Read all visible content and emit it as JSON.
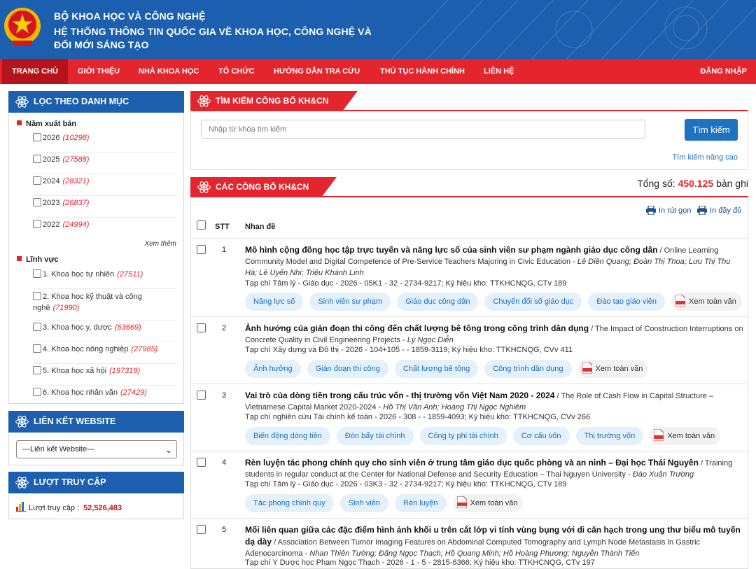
{
  "header": {
    "line1": "BỘ KHOA HỌC VÀ CÔNG NGHỆ",
    "line2": "HỆ THỐNG THÔNG TIN QUỐC GIA VỀ KHOA HỌC, CÔNG NGHỆ VÀ ĐỔI MỚI SÁNG TẠO"
  },
  "nav": {
    "items": [
      "TRANG CHỦ",
      "GIỚI THIỆU",
      "NHÀ KHOA HỌC",
      "TỔ CHỨC",
      "HƯỚNG DẪN TRA CỨU",
      "THỦ TỤC HÀNH CHÍNH",
      "LIÊN HỆ"
    ],
    "login": "ĐĂNG NHẬP"
  },
  "sidebar": {
    "filter_title": "LỌC THEO DANH MỤC",
    "year_title": "Năm xuất bản",
    "years": [
      {
        "label": "2026",
        "count": "(10298)"
      },
      {
        "label": "2025",
        "count": "(27588)"
      },
      {
        "label": "2024",
        "count": "(28321)"
      },
      {
        "label": "2023",
        "count": "(26837)"
      },
      {
        "label": "2022",
        "count": "(24994)"
      }
    ],
    "see_more": "Xem thêm",
    "field_title": "Lĩnh vực",
    "fields": [
      {
        "label": "1. Khoa học tự nhiên",
        "count": "(27511)"
      },
      {
        "label": "2. Khoa học kỹ thuật và công nghệ",
        "count": "(71990)"
      },
      {
        "label": "3. Khoa học y, dược",
        "count": "(63669)"
      },
      {
        "label": "4. Khoa học nông nghiệp",
        "count": "(27985)"
      },
      {
        "label": "5. Khoa học xã hội",
        "count": "(197319)"
      },
      {
        "label": "6. Khoa học nhân văn",
        "count": "(27429)"
      }
    ],
    "links_title": "LIÊN KẾT WEBSITE",
    "links_select": "---Liên kết Website---",
    "visits_title": "LƯỢT TRUY CẬP",
    "visits_label": "Lượt truy cập :",
    "visits_value": "52,526,483"
  },
  "search": {
    "title": "TÌM KIẾM CÔNG BỐ KH&CN",
    "placeholder": "Nhập từ khóa tìm kiếm",
    "button": "Tìm kiếm",
    "advanced": "Tìm kiếm nâng cao"
  },
  "list": {
    "title": "CÁC CÔNG BỐ KH&CN",
    "total_label": "Tổng số:",
    "total_value": "450.125",
    "total_unit": "bản ghi",
    "print_short": "In rút gọn",
    "print_full": "In đầy đủ",
    "col_stt": "STT",
    "col_title": "Nhan đề",
    "fulltext_label": "Xem toàn văn",
    "items": [
      {
        "stt": "1",
        "title_vi": "Mô hình cộng đồng học tập trực tuyến và năng lực số của sinh viên sư phạm ngành giáo dục công dân",
        "title_en": " / Online Learning Community Model and Digital Competence of Pre-Service Teachers Majoring in Civic Education - ",
        "authors": "Lê Diên Quang; Đoàn Thị Thoa; Lưu Thị Thu Hà; Lê Uyển Nhi; Triệu Khánh Linh",
        "journal": "Tạp chí Tâm lý - Giáo dục - 2026 - 05K1 - 32 - 2734-9217; Ký hiệu kho: TTKHCNQG, CTv 189",
        "tags": [
          "Năng lực số",
          "Sinh viên sư phạm",
          "Giáo dục công dân",
          "Chuyển đổi số giáo dục",
          "Đào tạo giáo viên"
        ]
      },
      {
        "stt": "2",
        "title_vi": "Ảnh hưởng của gián đoạn thi công đến chất lượng bê tông trong công trình dân dụng",
        "title_en": " / The Impact of Construction Interruptions on Concrete Quality in Civil Engineering Projects - ",
        "authors": "Lý Ngọc Diễn",
        "journal": "Tạp chí Xây dựng và Đô thị - 2026 - 104+105 - - 1859-3119; Ký hiệu kho: TTKHCNQG, CVv 411",
        "tags": [
          "Ảnh hưởng",
          "Gián đoạn thi công",
          "Chất lượng bê tông",
          "Công trình dân dụng"
        ]
      },
      {
        "stt": "3",
        "title_vi": "Vai trò của dòng tiền trong cấu trúc vốn - thị trường vốn Việt Nam 2020 - 2024",
        "title_en": " / The Role of Cash Flow in Capital Structure – Vietnamese Capital Market 2020-2024 - ",
        "authors": "Hồ Thị Vân Anh; Hoàng Thị Ngọc Nghiêm",
        "journal": "Tạp chí nghiên cứu Tài chính kế toán - 2026 - 308 - - 1859-4093; Ký hiệu kho: TTKHCNQG, CVv 266",
        "tags": [
          "Biến động dòng tiền",
          "Đòn bẩy tài chính",
          "Công ty phi tài chính",
          "Cơ cấu vốn",
          "Thị trường vốn"
        ]
      },
      {
        "stt": "4",
        "title_vi": "Rèn luyện tác phong chính quy cho sinh viên ở trung tâm giáo dục quốc phòng và an ninh – Đại học Thái Nguyên",
        "title_en": " / Training students in regular conduct at the Center for National Defense and Security Education – Thai Nguyen University - ",
        "authors": "Đào Xuân Trường",
        "journal": "Tạp chí Tâm lý - Giáo dục - 2026 - 03K3 - 32 - 2734-9217; Ký hiệu kho: TTKHCNQG, CTv 189",
        "tags": [
          "Tác phong chính quy",
          "Sinh viên",
          "Rèn luyện"
        ]
      },
      {
        "stt": "5",
        "title_vi": "Mối liên quan giữa các đặc điểm hình ảnh khối u trên cắt lớp vi tính vùng bụng với di căn hạch trong ung thư biểu mô tuyến dạ dày",
        "title_en": " / Association Between Tumor Imaging Features on Abdominal Computed Tomography and Lymph Node Metastasis in Gastric Adenocarcinoma - ",
        "authors": "Nhan Thiên Tường; Đặng Ngọc Thạch; Hồ Quang Minh; Hồ Hoàng Phương; Nguyễn Thành Tiến",
        "journal": "Tạp chí Y Dược học Phạm Ngọc Thạch - 2026 - 1 - 5 - 2815-6366; Ký hiệu kho: TTKHCNQG, CTv 197",
        "tags": []
      }
    ]
  }
}
